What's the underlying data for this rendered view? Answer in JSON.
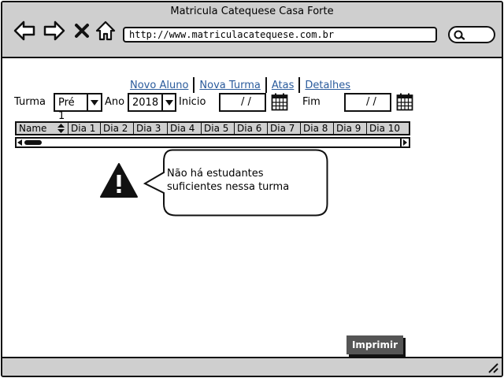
{
  "window": {
    "title": "Matricula Catequese Casa Forte"
  },
  "browser": {
    "url": "http://www.matriculacatequese.com.br",
    "icons": [
      "back-arrow-icon",
      "forward-arrow-icon",
      "close-icon",
      "home-icon",
      "search-icon"
    ]
  },
  "links": [
    "Novo Aluno",
    "Nova Turma",
    "Atas",
    "Detalhes"
  ],
  "link_color": "#2a5b9c",
  "filters": {
    "turma_label": "Turma",
    "turma_value": "Pré 1",
    "ano_label": "Ano",
    "ano_value": "2018",
    "inicio_label": "Inicio",
    "inicio_value": "/ /",
    "fim_label": "Fim",
    "fim_value": "/ /"
  },
  "table": {
    "columns": [
      "Name",
      "Dia 1",
      "Dia 2",
      "Dia 3",
      "Dia 4",
      "Dia 5",
      "Dia 6",
      "Dia 7",
      "Dia 8",
      "Dia 9",
      "Dia 10"
    ],
    "rows": []
  },
  "message": {
    "icon": "warning-icon",
    "text": "Não há estudantes suficientes nessa turma"
  },
  "actions": {
    "print_label": "Imprimir",
    "print_color": "#555555"
  }
}
